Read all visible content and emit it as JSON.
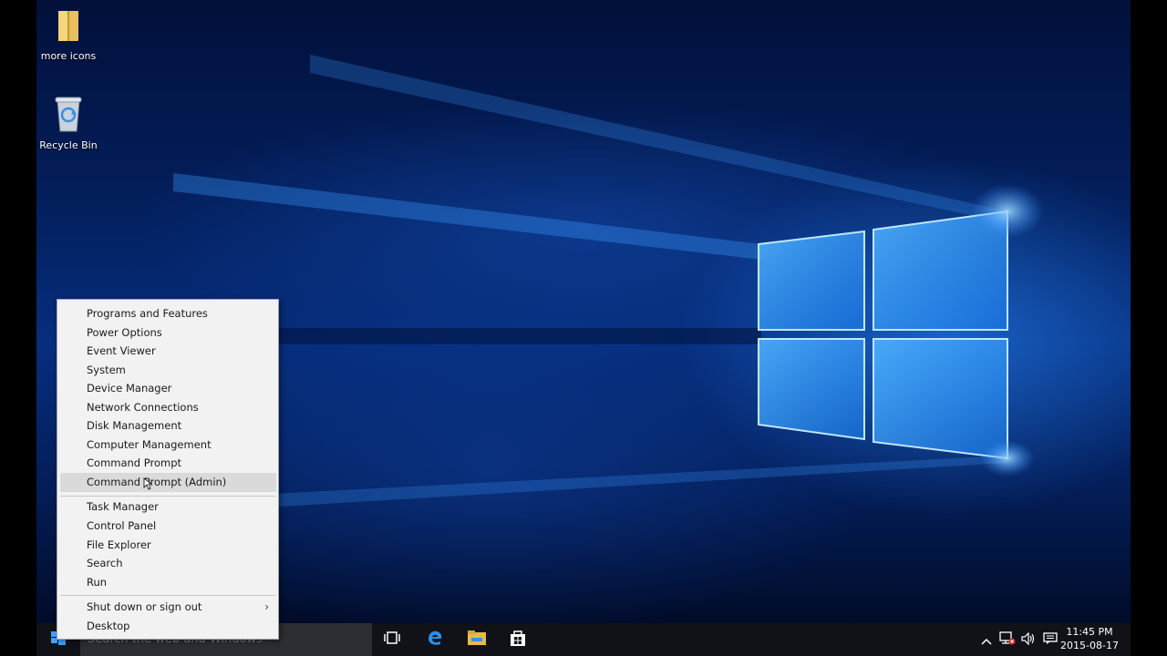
{
  "desktop": {
    "icons": [
      {
        "label": "more icons",
        "icon": "folder-icon"
      },
      {
        "label": "Recycle Bin",
        "icon": "recycle-bin-icon"
      }
    ]
  },
  "context_menu": {
    "group1": [
      "Programs and Features",
      "Power Options",
      "Event Viewer",
      "System",
      "Device Manager",
      "Network Connections",
      "Disk Management",
      "Computer Management",
      "Command Prompt",
      "Command Prompt (Admin)"
    ],
    "group2": [
      "Task Manager",
      "Control Panel",
      "File Explorer",
      "Search",
      "Run"
    ],
    "group3": [
      "Shut down or sign out",
      "Desktop"
    ],
    "highlighted": "Command Prompt (Admin)"
  },
  "taskbar": {
    "search_placeholder": "Search the web and Windows",
    "icons": [
      "start-icon",
      "task-view-icon",
      "edge-icon",
      "file-explorer-icon",
      "store-icon"
    ],
    "tray_icons": [
      "chevron-up-icon",
      "network-icon",
      "volume-icon",
      "action-center-icon"
    ],
    "clock": {
      "time": "11:45 PM",
      "date": "2015-08-17"
    }
  },
  "colors": {
    "accent": "#1e90ff",
    "taskbar": "#101217",
    "menu_bg": "#f2f2f2"
  }
}
